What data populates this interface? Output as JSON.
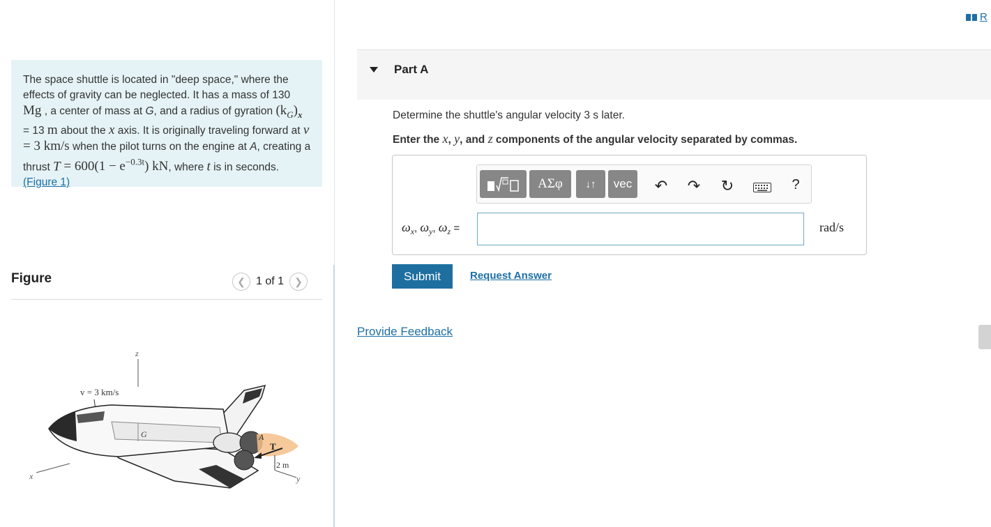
{
  "header": {
    "reader_label": "R"
  },
  "problem": {
    "t1": "The space shuttle is located in \"deep space,\" where the effects of gravity can be neglected. It has a mass of 130 ",
    "mass_unit": "Mg",
    "t2": " , a center of mass at ",
    "G": "G",
    "t3": ", and a radius of gyration ",
    "kG": "(k",
    "kG_sub": "G",
    "kG_close": ")",
    "kG_x": "x",
    "t4": " = 13 ",
    "m_unit": "m",
    "t5": " about the ",
    "xaxis": "x",
    "t6": " axis. It is originally traveling forward at ",
    "v": "v",
    "v_eq": " = 3 km/s",
    "t7": " when the pilot turns on the engine at ",
    "A": "A",
    "t8": ", creating a thrust ",
    "T": "T",
    "T_eq": " = 600(1 − e",
    "T_exp": "−0.3t",
    "T_close": ") kN",
    "t9": ", where ",
    "t": "t",
    "t10": " is in seconds.",
    "fig_link": "(Figure 1)"
  },
  "figure": {
    "title": "Figure",
    "pager": "1 of 1",
    "prev_icon": "chevron-left-icon",
    "next_icon": "chevron-right-icon",
    "labels": {
      "z": "z",
      "v": "v = 3 km/s",
      "G": "G",
      "A": "A",
      "T": "T",
      "dist": "2 m",
      "x": "x",
      "y": "y"
    }
  },
  "part": {
    "title": "Part A",
    "question": "Determine the shuttle's angular velocity 3 s later.",
    "instr_a": "Enter the ",
    "instr_x": "x",
    "instr_c1": ", ",
    "instr_y": "y",
    "instr_c2": ", and ",
    "instr_z": "z",
    "instr_b": " components of the angular velocity separated by commas."
  },
  "toolbar": {
    "templates_icon": "templates-icon",
    "greek_label": "ΑΣφ",
    "arrows_label": "↓↑",
    "vec_label": "vec",
    "undo_icon": "undo-icon",
    "redo_icon": "redo-icon",
    "reset_icon": "reset-icon",
    "keyboard_icon": "keyboard-icon",
    "help_label": "?"
  },
  "answer": {
    "lhs_w1": "ω",
    "lhs_s1": "x",
    "lhs_w2": "ω",
    "lhs_s2": "y",
    "lhs_w3": "ω",
    "lhs_s3": "z",
    "lhs_eq": " =",
    "value": "",
    "units": "rad/s"
  },
  "actions": {
    "submit": "Submit",
    "request": "Request Answer",
    "feedback": "Provide Feedback"
  },
  "colors": {
    "link": "#1d6fa5",
    "submit_bg": "#1e6fa0",
    "problem_bg": "#e6f3f6",
    "toolbar_btn": "#878787"
  }
}
